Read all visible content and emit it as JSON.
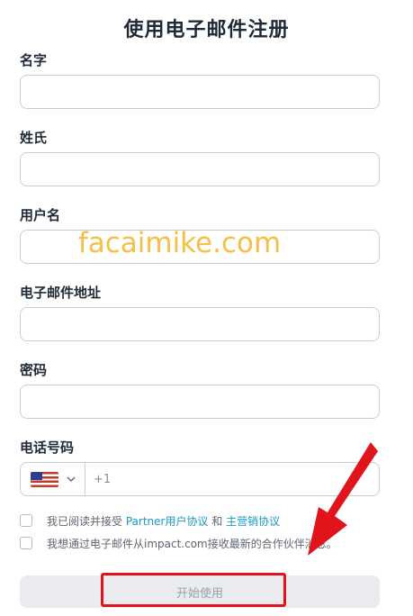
{
  "page_title": "使用电子邮件注册",
  "fields": {
    "first_name": {
      "label": "名字",
      "value": ""
    },
    "last_name": {
      "label": "姓氏",
      "value": ""
    },
    "username": {
      "label": "用户名",
      "value": ""
    },
    "email": {
      "label": "电子邮件地址",
      "value": ""
    },
    "password": {
      "label": "密码",
      "value": ""
    },
    "phone": {
      "label": "电话号码",
      "country": "US",
      "placeholder": "+1",
      "value": ""
    }
  },
  "agreements": {
    "terms": {
      "checked": false,
      "prefix": "我已阅读并接受 ",
      "link1": "Partner用户协议",
      "middle": " 和 ",
      "link2": "主营销协议"
    },
    "marketing": {
      "checked": false,
      "text": "我想通过电子邮件从impact.com接收最新的合作伙伴消息。"
    }
  },
  "submit_label": "开始使用",
  "watermark": "facaimike.com",
  "colors": {
    "link": "#1a9ac9",
    "annotation": "#e2141b",
    "watermark": "#f5c04a",
    "button_bg": "#e9ebee"
  },
  "icons": {
    "flag": "us-flag-icon",
    "dropdown": "chevron-down-icon",
    "annotation": "red-arrow-icon"
  }
}
